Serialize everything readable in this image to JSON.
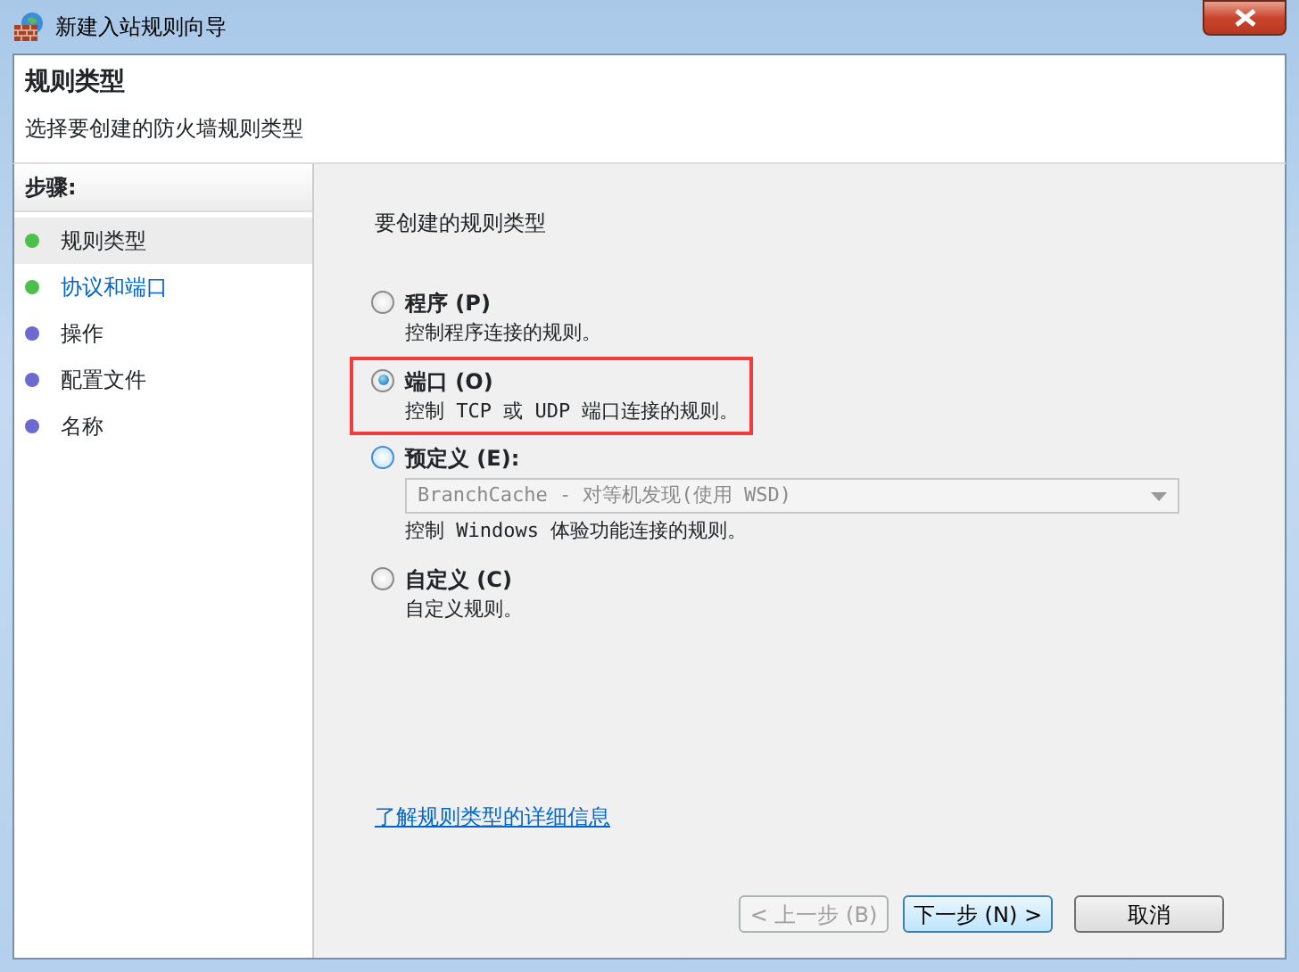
{
  "window": {
    "title": "新建入站规则向导"
  },
  "header": {
    "title": "规则类型",
    "subtitle": "选择要创建的防火墙规则类型"
  },
  "steps": {
    "heading": "步骤:",
    "items": [
      {
        "label": "规则类型",
        "selected": true,
        "linked": false,
        "color": "#4cc04c"
      },
      {
        "label": "协议和端口",
        "selected": false,
        "linked": true,
        "color": "#4cc04c"
      },
      {
        "label": "操作",
        "selected": false,
        "linked": false,
        "color": "#6a6ad0"
      },
      {
        "label": "配置文件",
        "selected": false,
        "linked": false,
        "color": "#6a6ad0"
      },
      {
        "label": "名称",
        "selected": false,
        "linked": false,
        "color": "#6a6ad0"
      }
    ]
  },
  "prompt": "要创建的规则类型",
  "options": [
    {
      "label": "程序 (P)",
      "description": "控制程序连接的规则。",
      "selected": false,
      "hover": false,
      "highlighted": false
    },
    {
      "label": "端口 (O)",
      "description": "控制 TCP 或 UDP 端口连接的规则。",
      "selected": true,
      "hover": false,
      "highlighted": true
    },
    {
      "label": "预定义 (E):",
      "dropdown": {
        "value": "BranchCache - 对等机发现(使用 WSD)",
        "disabled": true
      },
      "description": "控制 Windows 体验功能连接的规则。",
      "selected": false,
      "hover": true,
      "highlighted": false
    },
    {
      "label": "自定义 (C)",
      "description": "自定义规则。",
      "selected": false,
      "hover": false,
      "highlighted": false
    }
  ],
  "help_link": "了解规则类型的详细信息",
  "buttons": [
    {
      "label": "< 上一步 (B)",
      "disabled": true,
      "default": false
    },
    {
      "label": "下一步 (N) >",
      "disabled": false,
      "default": true
    },
    {
      "label": "取消",
      "disabled": false,
      "default": false
    }
  ]
}
